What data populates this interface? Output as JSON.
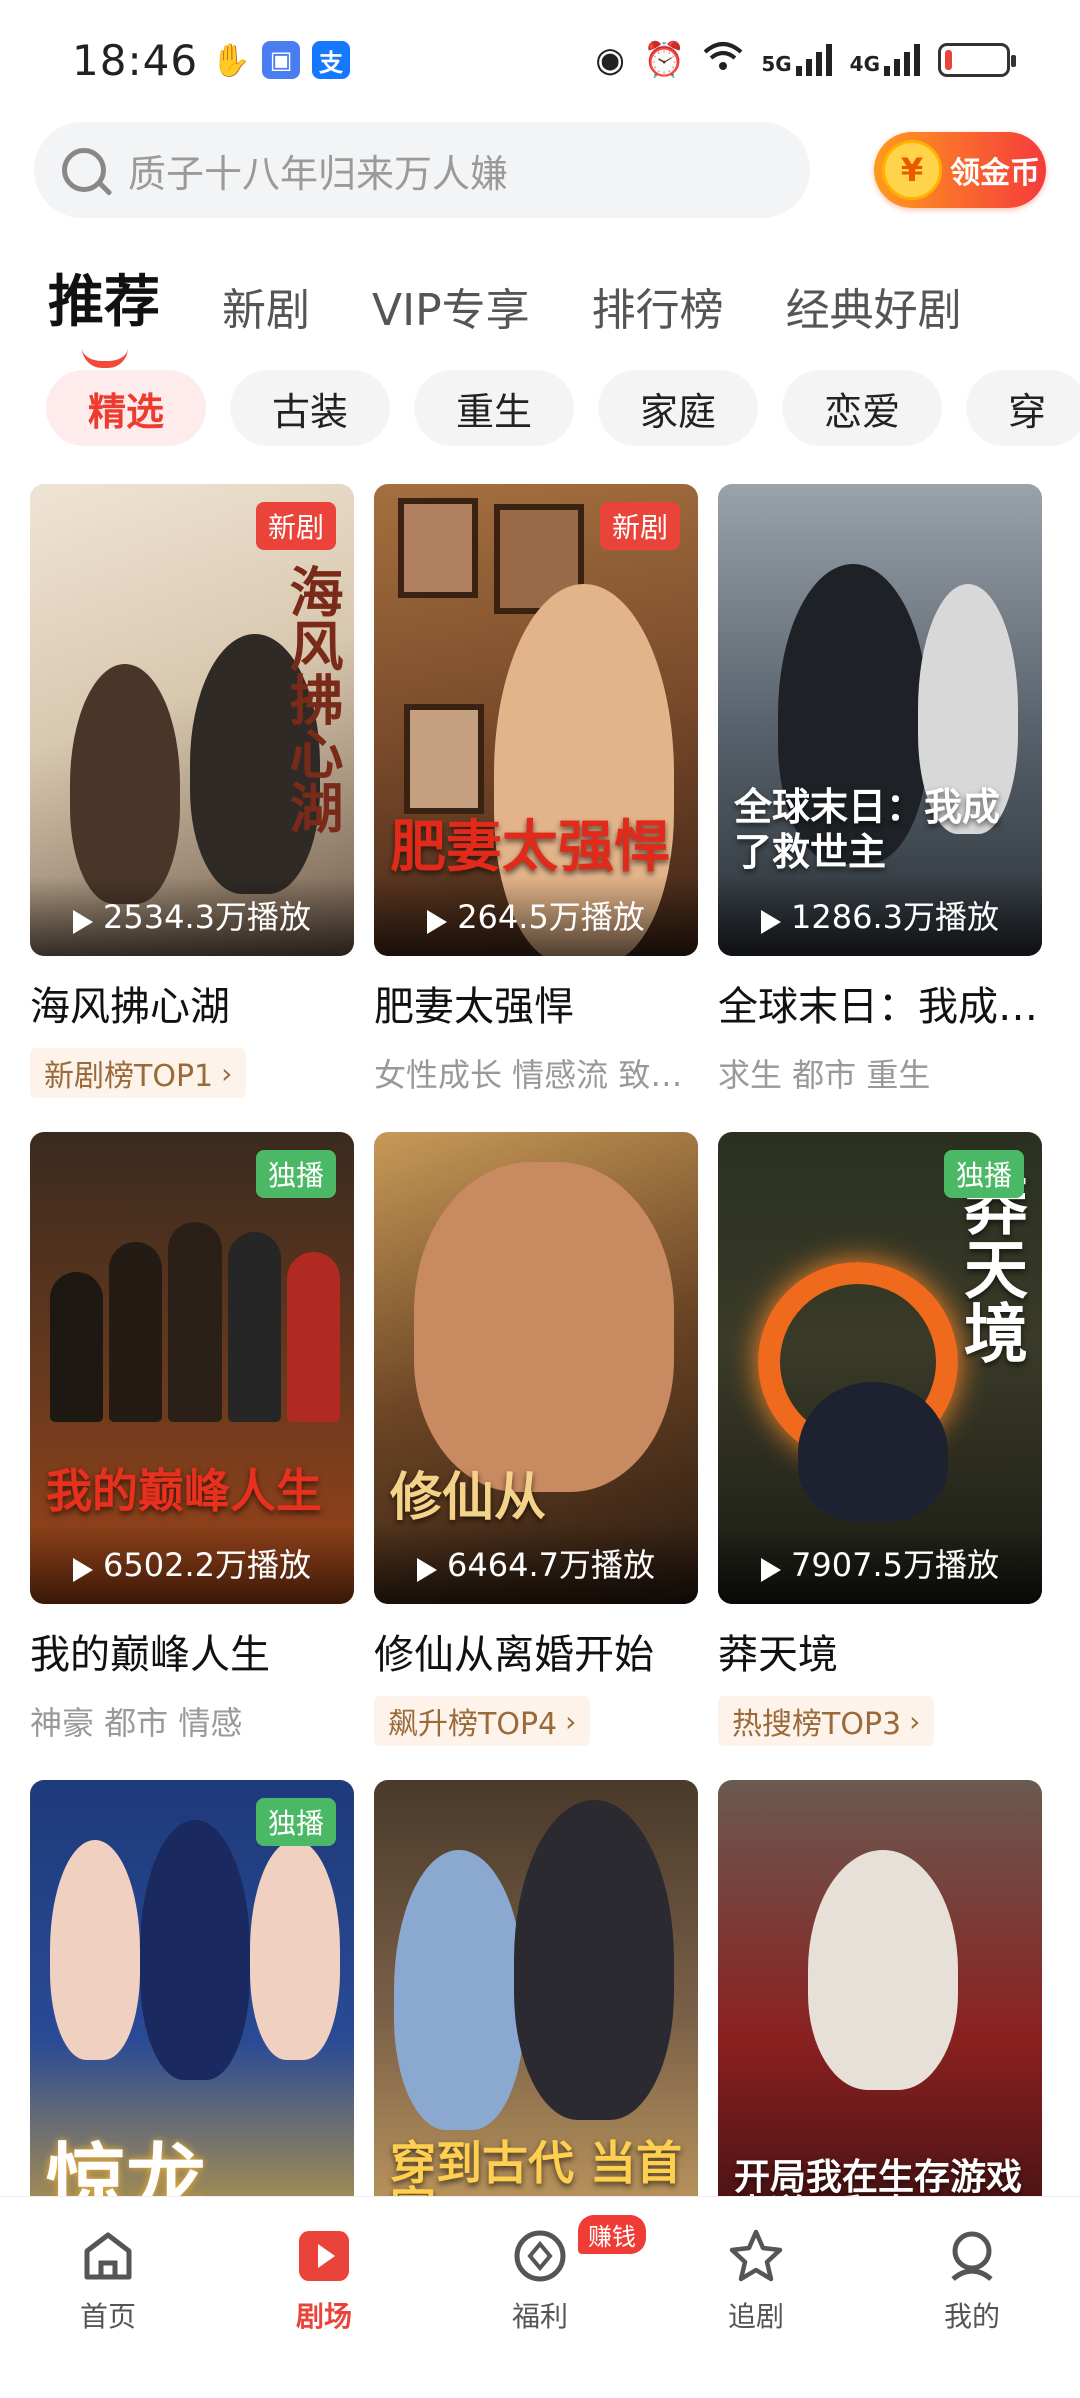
{
  "status_bar": {
    "time": "18:46",
    "left_icons": [
      "hand-icon",
      "screenshot-app-icon",
      "alipay-icon"
    ],
    "alipay_glyph": "支",
    "right_icons": [
      "eye-icon",
      "alarm-icon",
      "wifi-6-icon",
      "5g-signal-icon",
      "4g-signal-icon",
      "battery-low-icon"
    ],
    "network_1": "5G",
    "network_2": "4G",
    "battery_level": 0.12
  },
  "search": {
    "placeholder": "质子十八年归来万人嫌",
    "coin_button": "领金币",
    "coin_symbol": "¥"
  },
  "tabs": [
    {
      "label": "推荐",
      "active": true
    },
    {
      "label": "新剧",
      "active": false
    },
    {
      "label": "VIP专享",
      "active": false
    },
    {
      "label": "排行榜",
      "active": false
    },
    {
      "label": "经典好剧",
      "active": false
    }
  ],
  "chips": [
    {
      "label": "精选",
      "active": true
    },
    {
      "label": "古装",
      "active": false
    },
    {
      "label": "重生",
      "active": false
    },
    {
      "label": "家庭",
      "active": false
    },
    {
      "label": "恋爱",
      "active": false
    },
    {
      "label": "穿",
      "active": false
    }
  ],
  "dramas": [
    {
      "title": "海风拂心湖",
      "badge": "新剧",
      "plays": "2534.3万播放",
      "rank": "新剧榜TOP1",
      "tags": "",
      "poster_text": "海风拂心湖"
    },
    {
      "title": "肥妻太强悍",
      "badge": "新剧",
      "plays": "264.5万播放",
      "rank": "",
      "tags": "女性成长 情感流 致…",
      "poster_text": "肥妻太强悍"
    },
    {
      "title": "全球末日：我成…",
      "badge": "",
      "plays": "1286.3万播放",
      "rank": "",
      "tags": "求生 都市 重生",
      "poster_text": "全球末日：我成了救世主"
    },
    {
      "title": "我的巅峰人生",
      "badge": "独播",
      "plays": "6502.2万播放",
      "rank": "",
      "tags": "神豪 都市 情感",
      "poster_text": "我的巅峰人生"
    },
    {
      "title": "修仙从离婚开始",
      "badge": "",
      "plays": "6464.7万播放",
      "rank": "飙升榜TOP4",
      "tags": "",
      "poster_text": "修仙从"
    },
    {
      "title": "莽天境",
      "badge": "独播",
      "plays": "7907.5万播放",
      "rank": "热搜榜TOP3",
      "tags": "",
      "poster_text": "莽天境"
    },
    {
      "title": "",
      "badge": "独播",
      "plays": "",
      "rank": "",
      "tags": "",
      "poster_text": "惊龙"
    },
    {
      "title": "",
      "badge": "",
      "plays": "",
      "rank": "",
      "tags": "",
      "poster_text": "穿到古代 当首富"
    },
    {
      "title": "",
      "badge": "",
      "plays": "",
      "rank": "",
      "tags": "",
      "poster_text": "开局我在生存游戏中逆风翻盘"
    }
  ],
  "bottom_nav": [
    {
      "label": "首页",
      "icon": "home-icon",
      "active": false
    },
    {
      "label": "剧场",
      "icon": "theater-play-icon",
      "active": true
    },
    {
      "label": "福利",
      "icon": "welfare-coin-icon",
      "active": false,
      "badge": "赚钱"
    },
    {
      "label": "追剧",
      "icon": "follow-star-icon",
      "active": false
    },
    {
      "label": "我的",
      "icon": "profile-icon",
      "active": false
    }
  ],
  "colors": {
    "accent": "#e9433a",
    "exclusive_badge": "#4bb866",
    "rank_tag_text": "#9a6a3a"
  }
}
